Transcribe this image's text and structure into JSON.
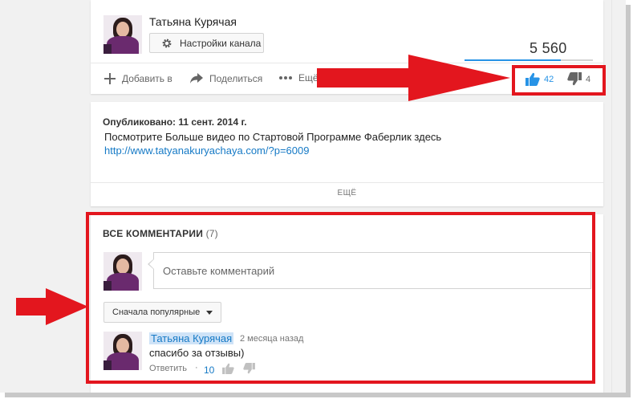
{
  "channel": {
    "name": "Татьяна Курячая",
    "settings_label": "Настройки канала"
  },
  "stats": {
    "views": "5 560",
    "likes": "42",
    "dislikes": "4",
    "view_bar_fraction": 0.75
  },
  "actions": {
    "add_label": "Добавить в",
    "share_label": "Поделиться",
    "more_label": "Ещё"
  },
  "description": {
    "published": "Опубликовано: 11 сент. 2014 г.",
    "text": "Посмотрите Больше видео по Стартовой Программе Фаберлик здесь",
    "link": "http://www.tatyanakuryachaya.com/?p=6009",
    "more_label": "ЕЩЁ"
  },
  "comments": {
    "title": "ВСЕ КОММЕНТАРИИ",
    "count": "(7)",
    "input_placeholder": "Оставьте комментарий",
    "sort_label": "Сначала популярные",
    "items": [
      {
        "author": "Татьяна Курячая",
        "time": "2 месяца назад",
        "text": "спасибо за отзывы)",
        "reply_label": "Ответить",
        "separator": "·",
        "likes": "10"
      }
    ]
  },
  "colors": {
    "annotation_red": "#e3161e",
    "link_blue": "#167ac6",
    "like_blue": "#2793e6"
  }
}
